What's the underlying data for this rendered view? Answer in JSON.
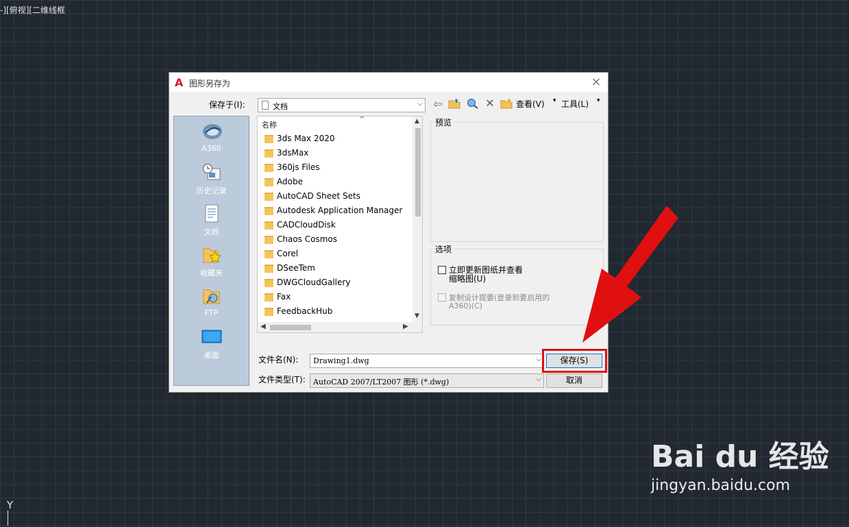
{
  "viewport": {
    "label": "-][俯视][二维线框",
    "ucs_axis": "Y"
  },
  "dialog": {
    "title": "图形另存为",
    "app_icon": "autocad-logo-icon",
    "close_label": "×",
    "save_in_label": "保存于(I):",
    "save_in_value": "文档",
    "toolbar": {
      "back_icon": "back-arrow-icon",
      "up_icon": "folder-up-icon",
      "search_icon": "search-web-icon",
      "delete_icon": "delete-icon",
      "new_folder_icon": "new-folder-icon",
      "view_label": "查看(V)",
      "tools_label": "工具(L)"
    },
    "places": [
      {
        "label": "A360",
        "icon": "a360-icon"
      },
      {
        "label": "历史记录",
        "icon": "history-icon"
      },
      {
        "label": "文档",
        "icon": "documents-icon"
      },
      {
        "label": "收藏夹",
        "icon": "favorites-icon"
      },
      {
        "label": "FTP",
        "icon": "ftp-icon"
      },
      {
        "label": "桌面",
        "icon": "desktop-icon"
      }
    ],
    "file_list": {
      "column_header": "名称",
      "items": [
        "3ds Max 2020",
        "3dsMax",
        "360js Files",
        "Adobe",
        "AutoCAD Sheet Sets",
        "Autodesk Application Manager",
        "CADCloudDisk",
        "Chaos Cosmos",
        "Corel",
        "DSeeTem",
        "DWGCloudGallery",
        "Fax",
        "FeedbackHub"
      ]
    },
    "preview_label": "预览",
    "options": {
      "title": "选项",
      "update_thumbnail_line1": "立即更新图纸并查看",
      "update_thumbnail_line2": "缩略图(U)",
      "copy_design_line1": "复制设计提要(登录到要启用的",
      "copy_design_line2": "A360)(C)"
    },
    "filename_label": "文件名(N):",
    "filename_value": "Drawing1.dwg",
    "filetype_label": "文件类型(T):",
    "filetype_value": "AutoCAD 2007/LT2007 图形 (*.dwg)",
    "save_button": "保存(S)",
    "cancel_button": "取消"
  },
  "annotation": {
    "arrow_color": "#e01010",
    "highlight_color": "#e01010"
  },
  "watermark": {
    "brand": "Bai du 经验",
    "url": "jingyan.baidu.com"
  }
}
